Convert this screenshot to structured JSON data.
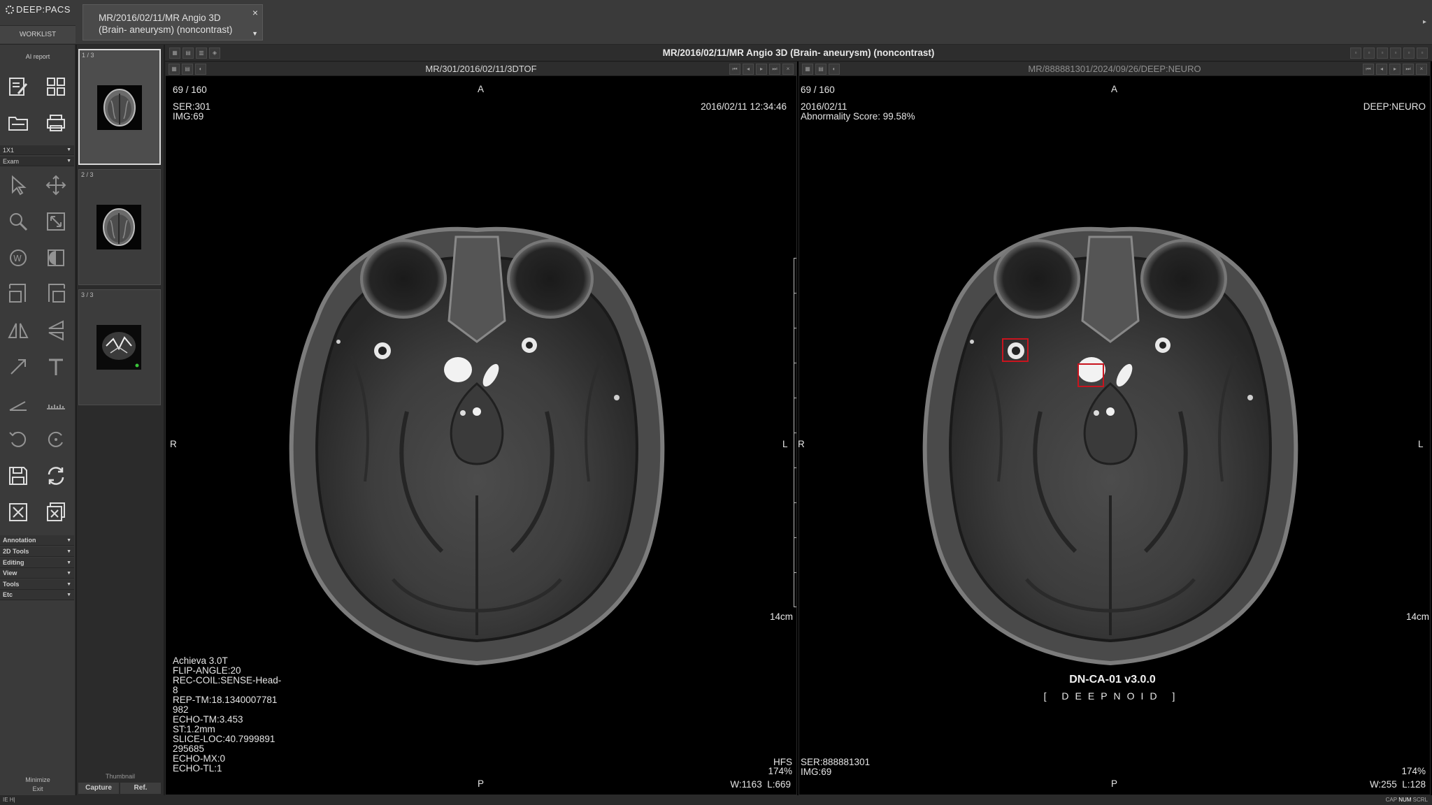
{
  "app": {
    "logo_text": "DEEP:PACS",
    "worklist_label": "WORKLIST",
    "ai_report_label": "AI report"
  },
  "study_tab": {
    "title": "MR/2016/02/11/MR Angio 3D (Brain- aneurysm) (noncontrast)",
    "close_glyph": "×",
    "dropdown_glyph": "▼"
  },
  "sidebar": {
    "layout_select": "1X1",
    "exam_select": "Exam",
    "sections": [
      "Annotation",
      "2D Tools",
      "Editing",
      "View",
      "Tools",
      "Etc"
    ],
    "minimize_label": "Minimize",
    "exit_label": "Exit",
    "tools": [
      "report-edit-icon",
      "layout-grid-icon",
      "open-folder-icon",
      "print-icon",
      "pointer-icon",
      "pan-icon",
      "zoom-icon",
      "fit-icon",
      "window-level-icon",
      "invert-icon",
      "rotate-left-icon",
      "rotate-right-icon",
      "flip-horizontal-icon",
      "flip-vertical-icon",
      "arrow-icon",
      "text-icon",
      "angle-icon",
      "ruler-icon",
      "undo-icon",
      "reset-icon",
      "save-icon",
      "refresh-icon",
      "close-icon",
      "close-all-icon"
    ]
  },
  "thumbnails": {
    "items": [
      {
        "label": "1 / 3",
        "active": true
      },
      {
        "label": "2 / 3",
        "active": false
      },
      {
        "label": "3 / 3",
        "active": false
      }
    ],
    "caption": "Thumbnail",
    "capture_label": "Capture",
    "ref_label": "Ref."
  },
  "viewer": {
    "title": "MR/2016/02/11/MR Angio 3D (Brain- aneurysm) (noncontrast)"
  },
  "panes": {
    "left": {
      "series_title": "MR/301/2016/02/11/3DTOF",
      "slice": "69 / 160",
      "ser": "SER:301",
      "img": "IMG:69",
      "datetime": "2016/02/11 12:34:46",
      "orient_top": "A",
      "orient_bottom": "P",
      "orient_left": "R",
      "orient_right": "L",
      "scale_label": "14cm",
      "params": [
        "Achieva 3.0T",
        "FLIP-ANGLE:20",
        "REC-COIL:SENSE-Head-",
        "8",
        "REP-TM:18.1340007781",
        "982",
        "ECHO-TM:3.453",
        "ST:1.2mm",
        "SLICE-LOC:40.7999891",
        "295685",
        "ECHO-MX:0",
        "ECHO-TL:1"
      ],
      "position": "HFS",
      "zoom": "174%",
      "wl": "W:1163  L:669"
    },
    "right": {
      "series_title": "MR/888881301/2024/09/26/DEEP:NEURO",
      "slice": "69 / 160",
      "date": "2016/02/11",
      "score": "Abnormality Score: 99.58%",
      "vendor": "DEEP:NEURO",
      "orient_top": "A",
      "orient_bottom": "P",
      "orient_left": "R",
      "orient_right": "L",
      "scale_label": "14cm",
      "ser": "SER:888881301",
      "img": "IMG:69",
      "zoom": "174%",
      "wl": "W:255  L:128",
      "model_name": "DN-CA-01 v3.0.0",
      "brand": "[ DEEPNOID ]",
      "detection_color": "#c8141e"
    }
  },
  "statusbar": {
    "left": "IE H|",
    "caps": "CAP",
    "num": "NUM",
    "scrl": "SCRL"
  }
}
